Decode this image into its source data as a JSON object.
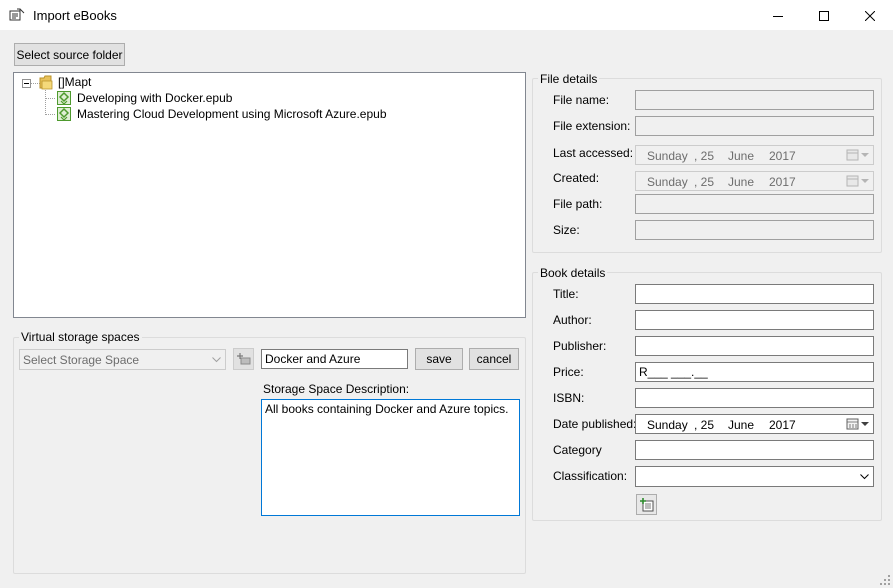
{
  "window": {
    "title": "Import eBooks"
  },
  "toolbar": {
    "select_source_label": "Select source folder"
  },
  "tree": {
    "root_label": "[]Mapt",
    "children": [
      "Developing with Docker.epub",
      "Mastering Cloud Development using Microsoft Azure.epub"
    ]
  },
  "storage": {
    "group_title": "Virtual storage spaces",
    "select_placeholder": "Select Storage Space",
    "name_value": "Docker and Azure",
    "save_label": "save",
    "cancel_label": "cancel",
    "description_label": "Storage Space Description:",
    "description_value": "All books containing Docker and Azure topics."
  },
  "file_details": {
    "group_title": "File details",
    "labels": {
      "name": "File name:",
      "extension": "File extension:",
      "last_accessed": "Last accessed:",
      "created": "Created:",
      "path": "File path:",
      "size": "Size:"
    },
    "last_accessed": {
      "day": "Sunday",
      "date": ", 25",
      "month": "June",
      "year": "2017"
    },
    "created": {
      "day": "Sunday",
      "date": ", 25",
      "month": "June",
      "year": "2017"
    }
  },
  "book_details": {
    "group_title": "Book details",
    "labels": {
      "title": "Title:",
      "author": "Author:",
      "publisher": "Publisher:",
      "price": "Price:",
      "isbn": "ISBN:",
      "date_published": "Date published:",
      "category": "Category",
      "classification": "Classification:"
    },
    "price_value": "R___ ___.__",
    "date_published": {
      "day": "Sunday",
      "date": ", 25",
      "month": "June",
      "year": "2017"
    }
  },
  "icons": {
    "app": "app-icon",
    "folder": "folder-icon",
    "epub": "epub-file-icon",
    "calendar": "calendar-icon",
    "add_storage": "add-storage-icon",
    "add_book": "add-book-icon"
  },
  "colors": {
    "window_bg": "#f0f0f0",
    "focus_border": "#0078d7",
    "epub_green": "#4e9a2e"
  }
}
